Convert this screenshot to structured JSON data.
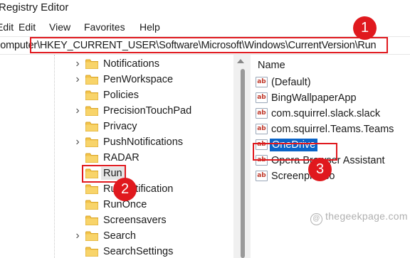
{
  "window": {
    "title": "Registry Editor"
  },
  "menu": [
    "Edit",
    "View",
    "Favorites",
    "Help"
  ],
  "address_bar": {
    "path": "Computer\\HKEY_CURRENT_USER\\Software\\Microsoft\\Windows\\CurrentVersion\\Run"
  },
  "tree": {
    "items": [
      {
        "label": "Notifications",
        "expandable": true
      },
      {
        "label": "PenWorkspace",
        "expandable": true
      },
      {
        "label": "Policies",
        "expandable": false
      },
      {
        "label": "PrecisionTouchPad",
        "expandable": true
      },
      {
        "label": "Privacy",
        "expandable": false
      },
      {
        "label": "PushNotifications",
        "expandable": true
      },
      {
        "label": "RADAR",
        "expandable": false
      },
      {
        "label": "Run",
        "expandable": false,
        "selected": true
      },
      {
        "label": "RunNotification",
        "expandable": false
      },
      {
        "label": "RunOnce",
        "expandable": false
      },
      {
        "label": "Screensavers",
        "expandable": false
      },
      {
        "label": "Search",
        "expandable": true
      },
      {
        "label": "SearchSettings",
        "expandable": false
      }
    ]
  },
  "values_pane": {
    "column_header": "Name",
    "icon_text": "ab",
    "items": [
      {
        "name": "(Default)"
      },
      {
        "name": "BingWallpaperApp"
      },
      {
        "name": "com.squirrel.slack.slack"
      },
      {
        "name": "com.squirrel.Teams.Teams"
      },
      {
        "name": "OneDrive",
        "selected": true
      },
      {
        "name": "Opera Browser Assistant"
      },
      {
        "name": "Screenpresso"
      }
    ]
  },
  "annotations": {
    "step1": "1",
    "step2": "2",
    "step3": "3",
    "color": "#e0191e"
  },
  "watermark": {
    "symbol": "@",
    "text": "thegeekpage.com"
  }
}
